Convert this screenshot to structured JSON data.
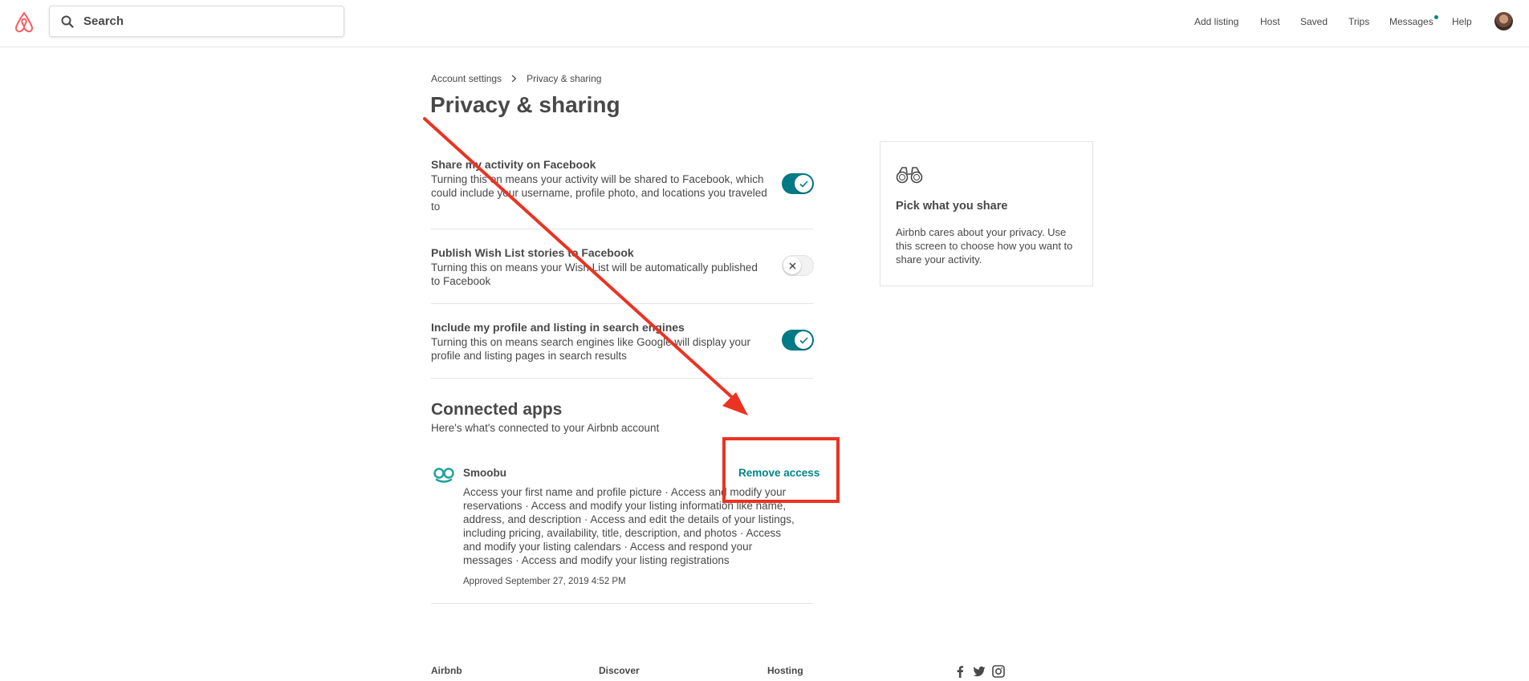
{
  "header": {
    "search_placeholder": "Search",
    "nav": {
      "add_listing": "Add listing",
      "host": "Host",
      "saved": "Saved",
      "trips": "Trips",
      "messages": "Messages",
      "help": "Help"
    }
  },
  "breadcrumb": {
    "parent": "Account settings",
    "current": "Privacy & sharing"
  },
  "page_title": "Privacy & sharing",
  "settings": [
    {
      "title": "Share my activity on Facebook",
      "description": "Turning this on means your activity will be shared to Facebook, which could include your username, profile photo, and locations you traveled to",
      "enabled": true
    },
    {
      "title": "Publish Wish List stories to Facebook",
      "description": "Turning this on means your Wish List will be automatically published to Facebook",
      "enabled": false
    },
    {
      "title": "Include my profile and listing in search engines",
      "description": "Turning this on means search engines like Google will display your profile and listing pages in search results",
      "enabled": true
    }
  ],
  "connected_apps": {
    "title": "Connected apps",
    "subtitle": "Here's what's connected to your Airbnb account",
    "apps": [
      {
        "name": "Smoobu",
        "remove_label": "Remove access",
        "description": "Access your first name and profile picture · Access and modify your reservations · Access and modify your listing information like name, address, and description · Access and edit the details of your listings, including pricing, availability, title, description, and photos · Access and modify your listing calendars · Access and respond your messages · Access and modify your listing registrations",
        "approved": "Approved September 27, 2019 4:52 PM"
      }
    ]
  },
  "info_card": {
    "icon": "binoculars-icon",
    "title": "Pick what you share",
    "description": "Airbnb cares about your privacy. Use this screen to choose how you want to share your activity."
  },
  "footer": {
    "col1": "Airbnb",
    "col2": "Discover",
    "col3": "Hosting",
    "social": [
      "facebook-icon",
      "twitter-icon",
      "instagram-icon"
    ]
  },
  "colors": {
    "brand": "#FF5A5F",
    "accent": "#008489",
    "toggle_on": "#007A87",
    "annotation": "#EA3323"
  }
}
